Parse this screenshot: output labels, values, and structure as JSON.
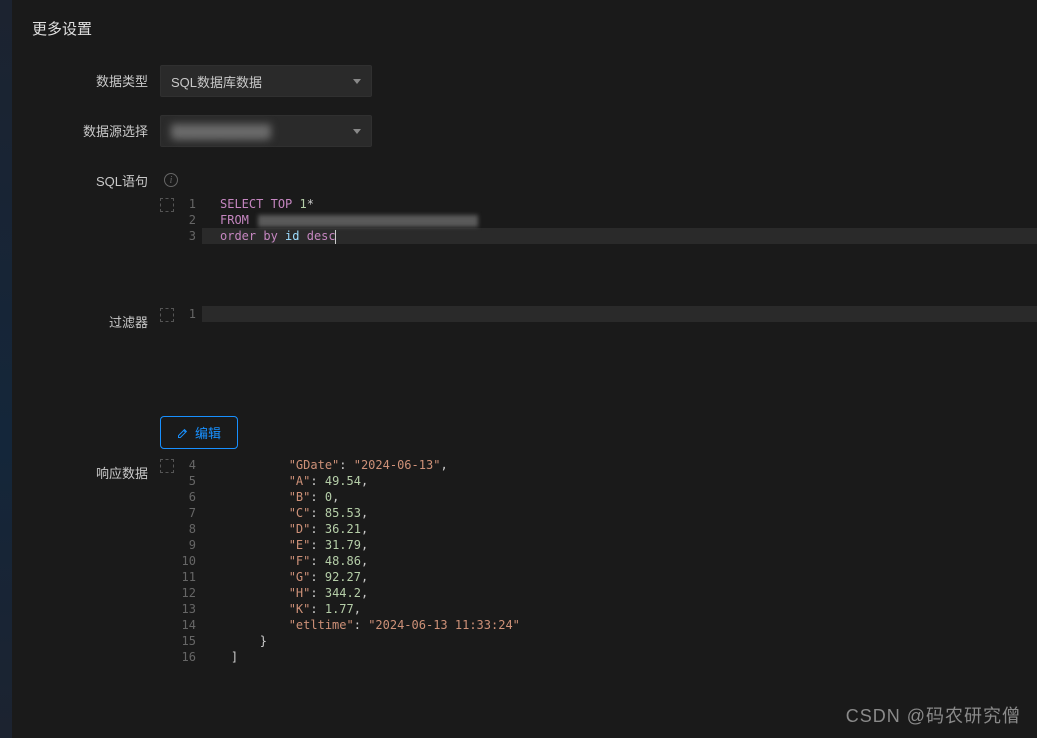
{
  "title": "更多设置",
  "fields": {
    "dataType": {
      "label": "数据类型",
      "value": "SQL数据库数据"
    },
    "dataSource": {
      "label": "数据源选择",
      "value": "██████████"
    },
    "sql": {
      "label": "SQL语句"
    },
    "filter": {
      "label": "过滤器"
    },
    "response": {
      "label": "响应数据"
    }
  },
  "sqlCode": {
    "lineNumbers": [
      "1",
      "2",
      "3"
    ],
    "tokens": {
      "select": "SELECT",
      "top": "TOP",
      "topN": "1",
      "star": "*",
      "from": "FROM",
      "orderBy": "order by",
      "id": "id",
      "desc": "desc"
    }
  },
  "filterCode": {
    "lineNumbers": [
      "1"
    ]
  },
  "editButton": "编辑",
  "responseCode": {
    "startLine": 4,
    "lines": [
      {
        "indent": 3,
        "key": "GDate",
        "value": "2024-06-13",
        "type": "string",
        "comma": true
      },
      {
        "indent": 3,
        "key": "A",
        "value": "49.54",
        "type": "number",
        "comma": true
      },
      {
        "indent": 3,
        "key": "B",
        "value": "0",
        "type": "number",
        "comma": true
      },
      {
        "indent": 3,
        "key": "C",
        "value": "85.53",
        "type": "number",
        "comma": true
      },
      {
        "indent": 3,
        "key": "D",
        "value": "36.21",
        "type": "number",
        "comma": true
      },
      {
        "indent": 3,
        "key": "E",
        "value": "31.79",
        "type": "number",
        "comma": true
      },
      {
        "indent": 3,
        "key": "F",
        "value": "48.86",
        "type": "number",
        "comma": true
      },
      {
        "indent": 3,
        "key": "G",
        "value": "92.27",
        "type": "number",
        "comma": true
      },
      {
        "indent": 3,
        "key": "H",
        "value": "344.2",
        "type": "number",
        "comma": true
      },
      {
        "indent": 3,
        "key": "K",
        "value": "1.77",
        "type": "number",
        "comma": true
      },
      {
        "indent": 3,
        "key": "etltime",
        "value": "2024-06-13 11:33:24",
        "type": "string",
        "comma": false
      },
      {
        "indent": 2,
        "raw": "}"
      },
      {
        "indent": 1,
        "raw": "]"
      }
    ]
  },
  "watermark": "CSDN @码农研究僧"
}
